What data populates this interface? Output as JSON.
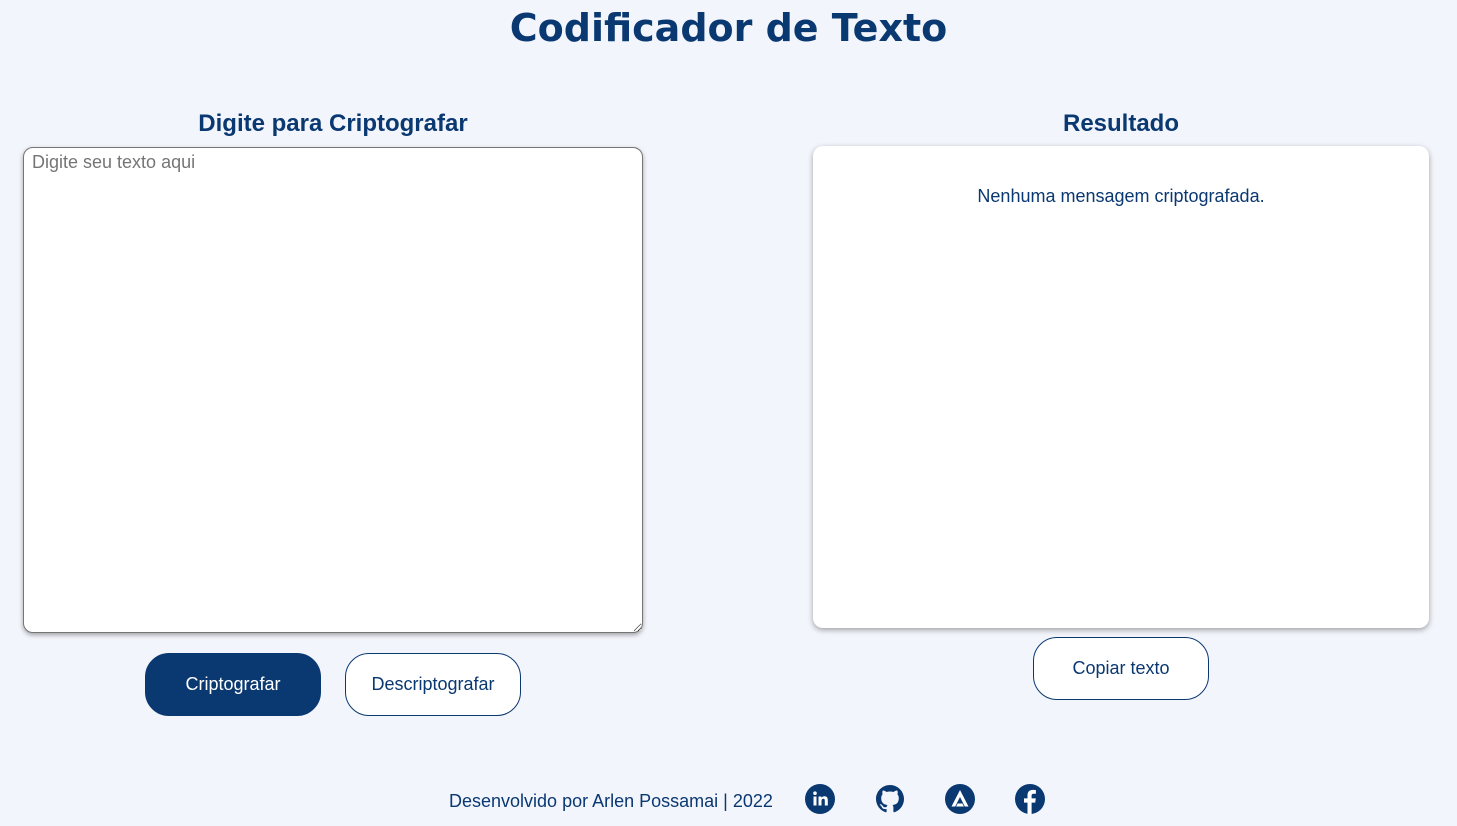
{
  "header": {
    "title": "Codificador de Texto"
  },
  "encrypt_section": {
    "heading": "Digite para Criptografar",
    "input_placeholder": "Digite seu texto aqui",
    "input_value": "",
    "encrypt_button": "Criptografar",
    "decrypt_button": "Descriptografar"
  },
  "result_section": {
    "heading": "Resultado",
    "empty_message": "Nenhuma mensagem criptografada.",
    "copy_button": "Copiar texto"
  },
  "footer": {
    "credit": "Desenvolvido por Arlen Possamai | 2022",
    "social_links": [
      {
        "icon": "linkedin-icon"
      },
      {
        "icon": "github-icon"
      },
      {
        "icon": "alura-icon"
      },
      {
        "icon": "facebook-icon"
      }
    ]
  },
  "colors": {
    "background": "#f3f5fc",
    "primary": "#0a3871",
    "panel": "#ffffff"
  }
}
